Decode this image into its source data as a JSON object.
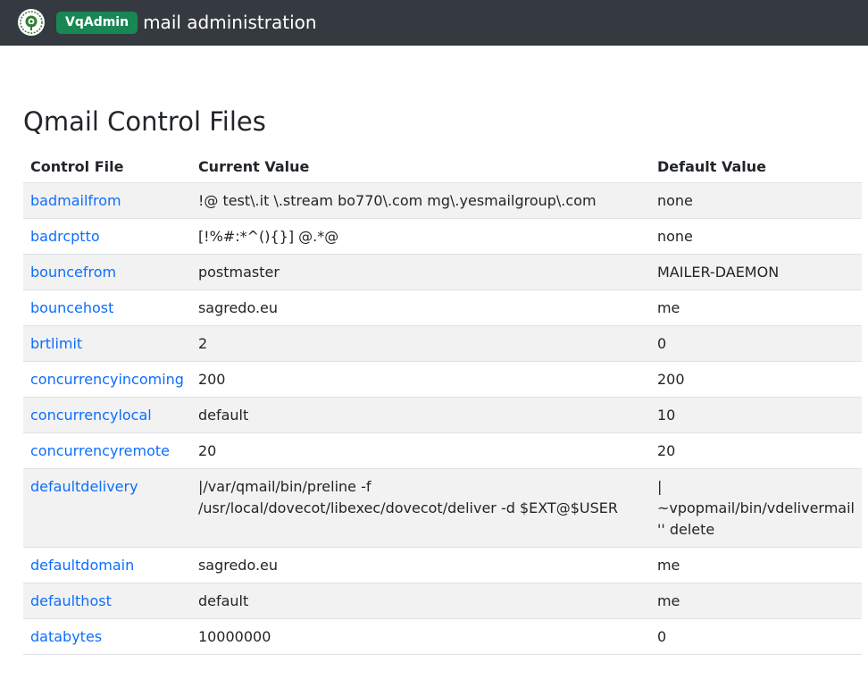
{
  "header": {
    "badge": "VqAdmin",
    "title": "mail administration"
  },
  "page": {
    "heading": "Qmail Control Files"
  },
  "table": {
    "columns": [
      "Control File",
      "Current Value",
      "Default Value"
    ],
    "rows": [
      {
        "name": "badmailfrom",
        "current": "!@ test\\.it \\.stream bo770\\.com mg\\.yesmailgroup\\.com",
        "default": "none"
      },
      {
        "name": "badrcptto",
        "current": "[!%#:*^(){}] @.*@",
        "default": "none"
      },
      {
        "name": "bouncefrom",
        "current": "postmaster",
        "default": "MAILER-DAEMON"
      },
      {
        "name": "bouncehost",
        "current": "sagredo.eu",
        "default": "me"
      },
      {
        "name": "brtlimit",
        "current": "2",
        "default": "0"
      },
      {
        "name": "concurrencyincoming",
        "current": "200",
        "default": "200"
      },
      {
        "name": "concurrencylocal",
        "current": "default",
        "default": "10"
      },
      {
        "name": "concurrencyremote",
        "current": "20",
        "default": "20"
      },
      {
        "name": "defaultdelivery",
        "current": "|/var/qmail/bin/preline -f /usr/local/dovecot/libexec/dovecot/deliver -d $EXT@$USER",
        "default": "| ~vpopmail/bin/vdelivermail '' delete"
      },
      {
        "name": "defaultdomain",
        "current": "sagredo.eu",
        "default": "me"
      },
      {
        "name": "defaulthost",
        "current": "default",
        "default": "me"
      },
      {
        "name": "databytes",
        "current": "10000000",
        "default": "0"
      }
    ]
  },
  "colors": {
    "navbar": "#343a40",
    "badge": "#198754",
    "link": "#0d6efd",
    "stripe": "#f2f2f2"
  },
  "icons": {
    "logo": "qmail-logo-icon"
  }
}
